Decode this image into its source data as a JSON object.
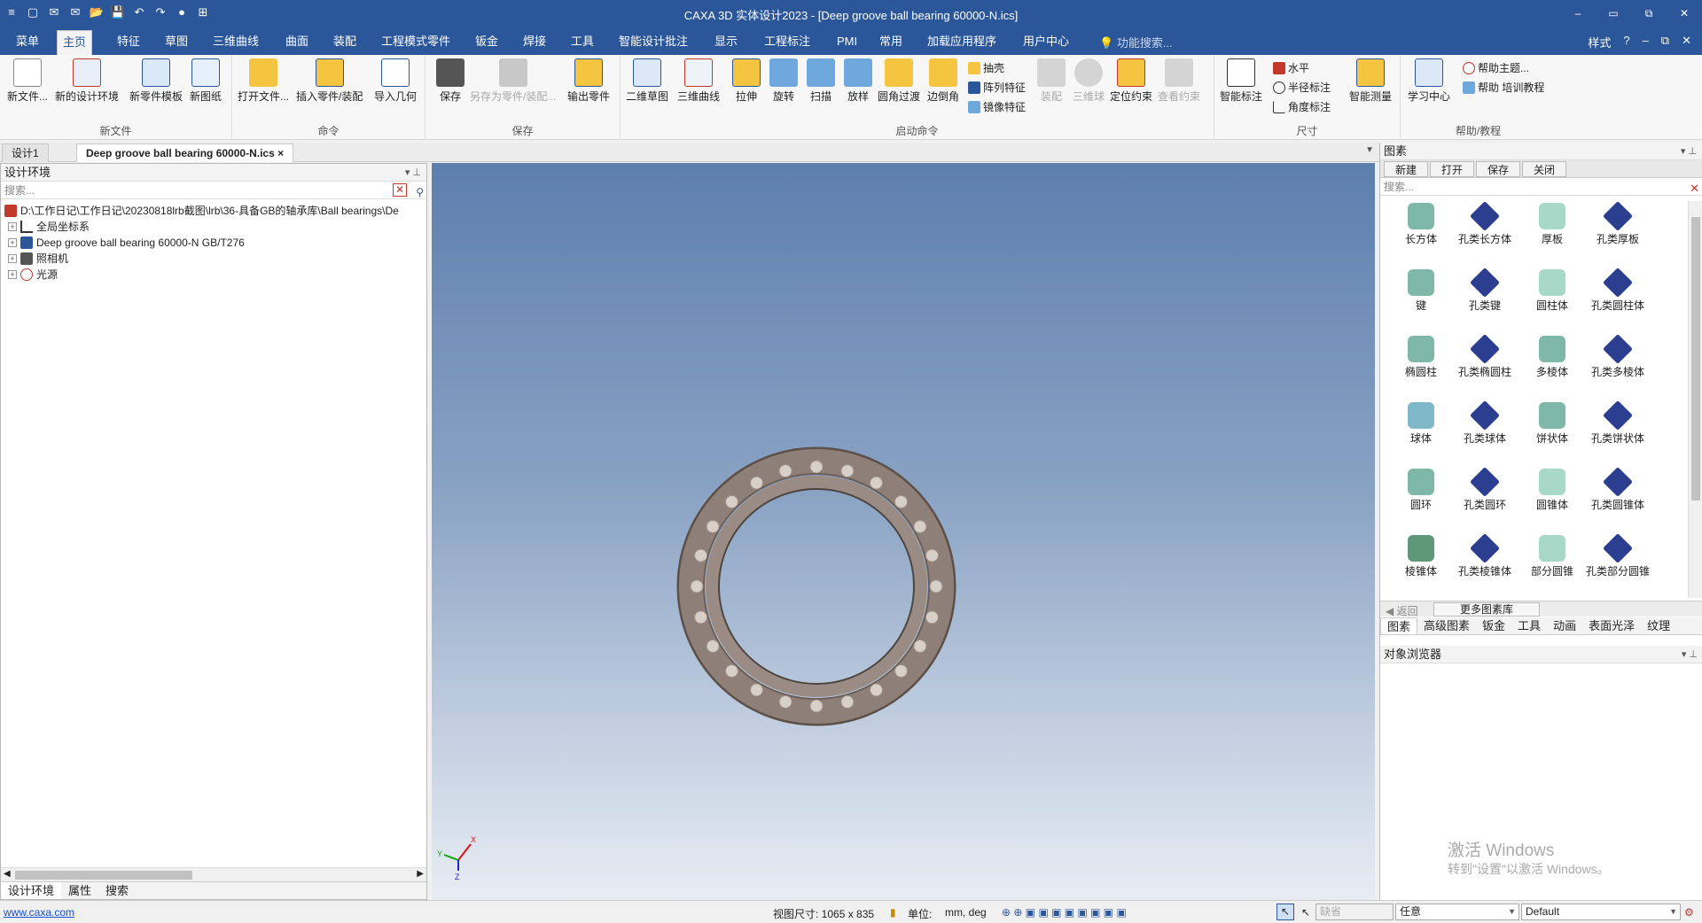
{
  "window": {
    "title": "CAXA 3D 实体设计2023 - [Deep groove ball bearing 60000-N.ics]",
    "controls": [
      "–",
      "▭",
      "⧉",
      "✕"
    ]
  },
  "quick_access": [
    "≡",
    "▢",
    "✉",
    "✉",
    "📂",
    "💾",
    "↶",
    "↷",
    "●",
    "⊞"
  ],
  "menu_tabs": [
    {
      "label": "菜单"
    },
    {
      "label": "主页"
    },
    {
      "label": "特征"
    },
    {
      "label": "草图"
    },
    {
      "label": "三维曲线"
    },
    {
      "label": "曲面"
    },
    {
      "label": "装配"
    },
    {
      "label": "工程模式零件"
    },
    {
      "label": "钣金"
    },
    {
      "label": "焊接"
    },
    {
      "label": "工具"
    },
    {
      "label": "智能设计批注"
    },
    {
      "label": "显示"
    },
    {
      "label": "工程标注"
    },
    {
      "label": "PMI"
    },
    {
      "label": "常用"
    },
    {
      "label": "加载应用程序"
    },
    {
      "label": "用户中心"
    }
  ],
  "function_search": "功能搜索...",
  "style_label": "样式",
  "ribbon": {
    "groups": {
      "new_file": "新文件",
      "command": "命令",
      "save": "保存",
      "launch": "启动命令",
      "dimension": "尺寸",
      "help": "帮助/教程"
    },
    "buttons": {
      "new_file": "新文件...",
      "new_design_env": "新的设计环境",
      "new_part_template": "新零件模板",
      "new_drawing": "新图纸",
      "open_file": "打开文件...",
      "insert_part": "插入零件/装配",
      "import_geometry": "导入几何",
      "save": "保存",
      "save_as_part": "另存为零件/装配...",
      "export_part": "输出零件",
      "sketch_2d": "二维草图",
      "curve_3d": "三维曲线",
      "extrude": "拉伸",
      "revolve": "旋转",
      "sweep": "扫描",
      "loft": "放样",
      "fillet": "圆角过渡",
      "chamfer": "边倒角",
      "shell": "抽壳",
      "pattern": "阵列特征",
      "mirror": "镜像特征",
      "assemble": "装配",
      "ball_3d": "三维球",
      "position_constraint": "定位约束",
      "view_constraint": "查看约束",
      "smart_dimension": "智能标注",
      "horizontal": "水平",
      "radius_dim": "半径标注",
      "angle_dim": "角度标注",
      "smart_measure": "智能测量",
      "learning_center": "学习中心",
      "help_topics": "帮助主题...",
      "help_training": "帮助 培训教程"
    }
  },
  "doc_tabs": [
    {
      "label": "设计1"
    },
    {
      "label": "Deep groove ball bearing 60000-N.ics",
      "close": "×"
    }
  ],
  "left_panel": {
    "title": "设计环境",
    "search_placeholder": "搜索...",
    "tree": [
      {
        "label": "D:\\工作日记\\工作日记\\20230818lrb截图\\lrb\\36-具备GB的轴承库\\Ball bearings\\De"
      },
      {
        "label": "全局坐标系"
      },
      {
        "label": "Deep groove ball bearing 60000-N GB/T276"
      },
      {
        "label": "照相机"
      },
      {
        "label": "光源"
      }
    ],
    "bottom_tabs": [
      "设计环境",
      "属性",
      "搜索"
    ]
  },
  "axes": {
    "x": "X",
    "y": "Y",
    "z": "Z"
  },
  "right_panel": {
    "title": "图素",
    "toolbar": [
      "新建",
      "打开",
      "保存",
      "关闭"
    ],
    "search_placeholder": "搜索...",
    "items": [
      {
        "label": "长方体",
        "color": "#7fb8a8"
      },
      {
        "label": "孔类长方体",
        "color": "#2c3e8f"
      },
      {
        "label": "厚板",
        "color": "#a8d8c8"
      },
      {
        "label": "孔类厚板",
        "color": "#2c3e8f"
      },
      {
        "label": "键",
        "color": "#7fb8a8"
      },
      {
        "label": "孔类键",
        "color": "#2c3e8f"
      },
      {
        "label": "圆柱体",
        "color": "#a8d8c8"
      },
      {
        "label": "孔类圆柱体",
        "color": "#2c3e8f"
      },
      {
        "label": "椭圆柱",
        "color": "#7fb8a8"
      },
      {
        "label": "孔类椭圆柱",
        "color": "#2c3e8f"
      },
      {
        "label": "多棱体",
        "color": "#7fb8a8"
      },
      {
        "label": "孔类多棱体",
        "color": "#2c3e8f"
      },
      {
        "label": "球体",
        "color": "#7fb8c8"
      },
      {
        "label": "孔类球体",
        "color": "#2c3e8f"
      },
      {
        "label": "饼状体",
        "color": "#7fb8a8"
      },
      {
        "label": "孔类饼状体",
        "color": "#2c3e8f"
      },
      {
        "label": "圆环",
        "color": "#7fb8a8"
      },
      {
        "label": "孔类圆环",
        "color": "#2c3e8f"
      },
      {
        "label": "圆锥体",
        "color": "#a8d8c8"
      },
      {
        "label": "孔类圆锥体",
        "color": "#2c3e8f"
      },
      {
        "label": "棱锥体",
        "color": "#5f9878"
      },
      {
        "label": "孔类棱锥体",
        "color": "#2c3e8f"
      },
      {
        "label": "部分圆锥",
        "color": "#a8d8c8"
      },
      {
        "label": "孔类部分圆锥",
        "color": "#2c3e8f"
      }
    ],
    "nav_back": "返回",
    "more_library": "更多图素库",
    "lib_tabs": [
      "图素",
      "高级图素",
      "钣金",
      "工具",
      "动画",
      "表面光泽",
      "纹理"
    ],
    "object_browser": "对象浏览器",
    "watermark_title": "激活 Windows",
    "watermark_sub": "转到\"设置\"以激活 Windows。"
  },
  "status": {
    "link": "www.caxa.com",
    "view_size": "视图尺寸: 1065 x  835",
    "unit_label": "单位:",
    "unit_value": "mm, deg",
    "filter_placeholder": "缺省",
    "select_mode": "任意",
    "style": "Default"
  },
  "colors": {
    "title_bar": "#2b579a",
    "ring": "#8e8078",
    "ball": "#d8cfc8"
  }
}
